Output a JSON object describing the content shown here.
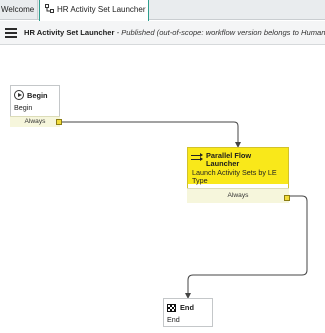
{
  "tabs": [
    {
      "label": "Welcome"
    },
    {
      "label": "HR Activity Set Launcher",
      "icon": "workflow-icon"
    }
  ],
  "header": {
    "title": "HR Activity Set Launcher",
    "status": " - Published  (out-of-scope: workflow version belongs to Human R"
  },
  "canvas": {
    "nodes": {
      "begin": {
        "title": "Begin",
        "desc": "Begin",
        "output": "Always",
        "icon": "play-circle-icon"
      },
      "parallel": {
        "title": "Parallel Flow Launcher",
        "desc": "Launch Activity Sets by LE Type",
        "output": "Always",
        "icon": "parallel-flow-icon",
        "highlight_color": "#f9e81a"
      },
      "end": {
        "title": "End",
        "desc": "End",
        "icon": "checkered-flag-icon"
      }
    }
  }
}
